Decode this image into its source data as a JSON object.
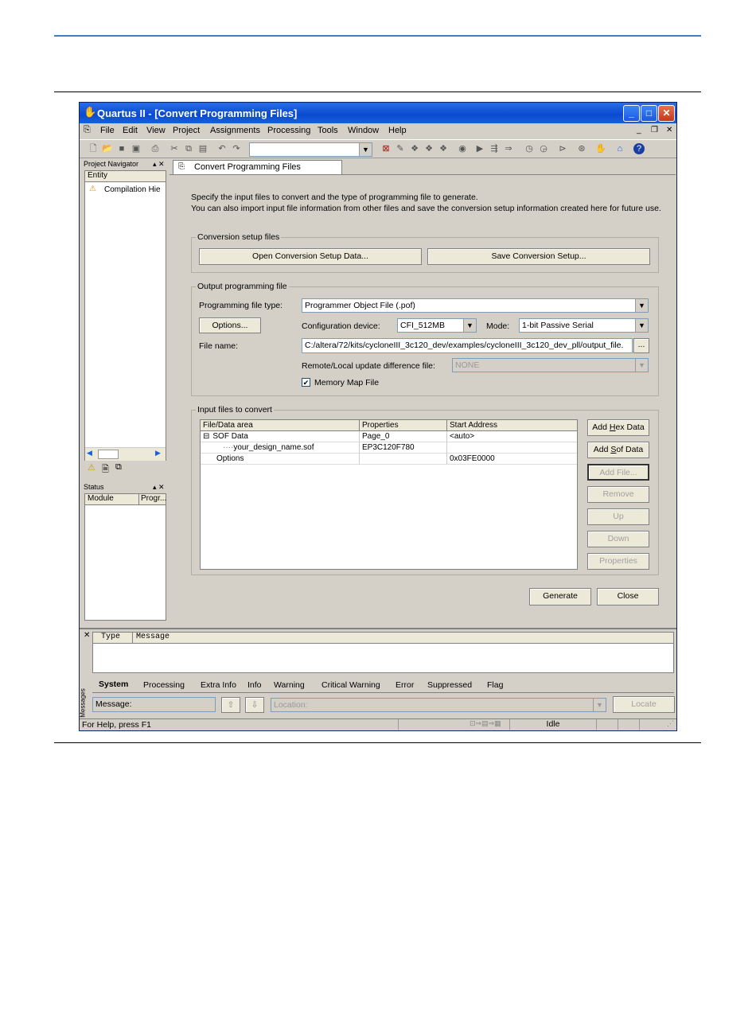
{
  "window": {
    "title": "Quartus II - [Convert Programming Files]"
  },
  "menu": [
    "File",
    "Edit",
    "View",
    "Project",
    "Assignments",
    "Processing",
    "Tools",
    "Window",
    "Help"
  ],
  "navigator": {
    "title": "Project Navigator",
    "column": "Entity",
    "item": "Compilation Hie"
  },
  "status_panel": {
    "title": "Status",
    "col_module": "Module",
    "col_progress": "Progr..."
  },
  "doc_tab": {
    "label": "Convert Programming Files"
  },
  "intro": {
    "line1": "Specify the input files to convert and the type of programming file to generate.",
    "line2": "You can also import input file information from other files and save the conversion setup information created here for future use."
  },
  "conversion_setup": {
    "title": "Conversion setup files",
    "open_button": "Open Conversion Setup Data...",
    "save_button": "Save Conversion Setup..."
  },
  "output": {
    "title": "Output programming file",
    "file_type_label": "Programming file type:",
    "file_type_value": "Programmer Object File (.pof)",
    "options_button": "Options...",
    "config_device_label": "Configuration device:",
    "config_device_value": "CFI_512MB",
    "mode_label": "Mode:",
    "mode_value": "1-bit Passive Serial",
    "file_name_label": "File name:",
    "file_name_value": "C:/altera/72/kits/cycloneIII_3c120_dev/examples/cycloneIII_3c120_dev_pll/output_file.",
    "browse_button": "...",
    "remote_label": "Remote/Local update difference file:",
    "remote_value": "NONE",
    "memory_map_label": "Memory Map File",
    "memory_map_checked": true
  },
  "input": {
    "title": "Input files to convert",
    "columns": [
      "File/Data area",
      "Properties",
      "Start Address"
    ],
    "rows": [
      {
        "file": "SOF Data",
        "props": "Page_0",
        "addr": "<auto>",
        "prefix": "⊟"
      },
      {
        "file": "your_design_name.sof",
        "props": "EP3C120F780",
        "addr": "",
        "prefix": "····"
      },
      {
        "file": "Options",
        "props": "",
        "addr": "0x03FE0000",
        "prefix": ""
      }
    ],
    "buttons": {
      "add_hex": "Add Hex Data",
      "add_sof": "Add Sof Data",
      "add_file": "Add File...",
      "remove": "Remove",
      "up": "Up",
      "down": "Down",
      "properties": "Properties"
    }
  },
  "actions": {
    "generate": "Generate",
    "close": "Close"
  },
  "messages": {
    "col_type": "Type",
    "col_message": "Message",
    "tabs": [
      "System",
      "Processing",
      "Extra Info",
      "Info",
      "Warning",
      "Critical Warning",
      "Error",
      "Suppressed",
      "Flag"
    ],
    "message_label": "Message:",
    "location_placeholder": "Location:",
    "locate_button": "Locate",
    "side_label": "Messages"
  },
  "statusbar": {
    "help": "For Help, press F1",
    "state": "Idle"
  }
}
